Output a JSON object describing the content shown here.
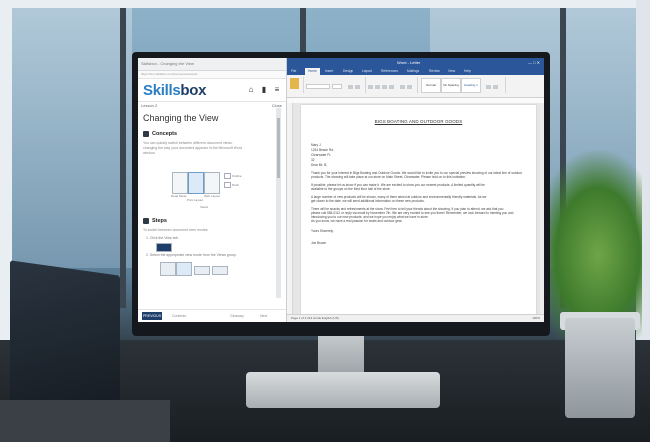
{
  "browser": {
    "tab_title": "Skillsbox - Changing the View",
    "address": "https://lms.skillsbox.com/course/view/word"
  },
  "skillsbox": {
    "logo_main": "Skills",
    "logo_accent": "box",
    "nav_left": "Lesson 2",
    "nav_right": "Close",
    "lesson_title": "Changing the View",
    "concepts_heading": "Concepts",
    "concepts_text": [
      "You can quickly switch between different document views,",
      "changing the way your document appears in the Microsoft Word",
      "window."
    ],
    "view_buttons": [
      "Read Mode",
      "Print Layout",
      "Web Layout"
    ],
    "view_group_label": "Views",
    "view_options": [
      "Outline",
      "Draft"
    ],
    "steps_heading": "Steps",
    "steps_intro": "To switch between document view modes:",
    "steps": [
      "1. Click the View tab.",
      "2. Select the appropriate view mode from the Views group."
    ],
    "footer": {
      "prev": "PREVIOUS",
      "mid": "Contents",
      "right_a": "Glossary",
      "right_b": "Next"
    },
    "accent_color": "#2d7fc4"
  },
  "word": {
    "title": "Word - Letter",
    "window_controls": "—  □  ✕",
    "tabs": [
      "File",
      "Home",
      "Insert",
      "Design",
      "Layout",
      "References",
      "Mailings",
      "Review",
      "View",
      "Help"
    ],
    "active_tab": "Home",
    "styles": [
      "Normal",
      "No Spacing",
      "Heading 1"
    ],
    "document": {
      "title": "BIGS BOATING AND OUTDOOR GOODS",
      "address_lines": [
        "Mary J.",
        "1234 Beach Rd.",
        "Clearwater FL",
        "32",
        "Dear Mr. B,"
      ],
      "body": [
        "Thank you for your interest in Bigs Boating and Outdoor Goods. We would like to invite you to our special preview showing of our latest line of outdoor",
        "products. The showing will take place at our store on Main Street, Clearwater. Please hold on to this invitation.",
        "If possible, please let us know if you can make it. We are excited to show you our newest products. A limited quantity will be",
        "available to the groups on the third floor hall of the store.",
        "A large number of new products will be shown, many of them aimed at outdoor and environmentally friendly materials. As we",
        "get closer to the date, we will send additional information on these new products.",
        "There will be snacks and refreshments at the show. Feel free to tell your friends about the showing. If you plan to attend, we ask that you",
        "please call 555-0112 or reply via email by November 7th. We are very excited to see you there! Remember, we look forward to meeting you and",
        "introducing you to our new products, and we hope you enjoy what we have in store.",
        "As you know, we have a real passion for boats and outdoor gear."
      ],
      "closing": "Yours Sincerely,",
      "signature": "Joe Brown"
    },
    "status_left": "Page 1 of 1   212 words   English (US)",
    "status_right": "100%"
  }
}
